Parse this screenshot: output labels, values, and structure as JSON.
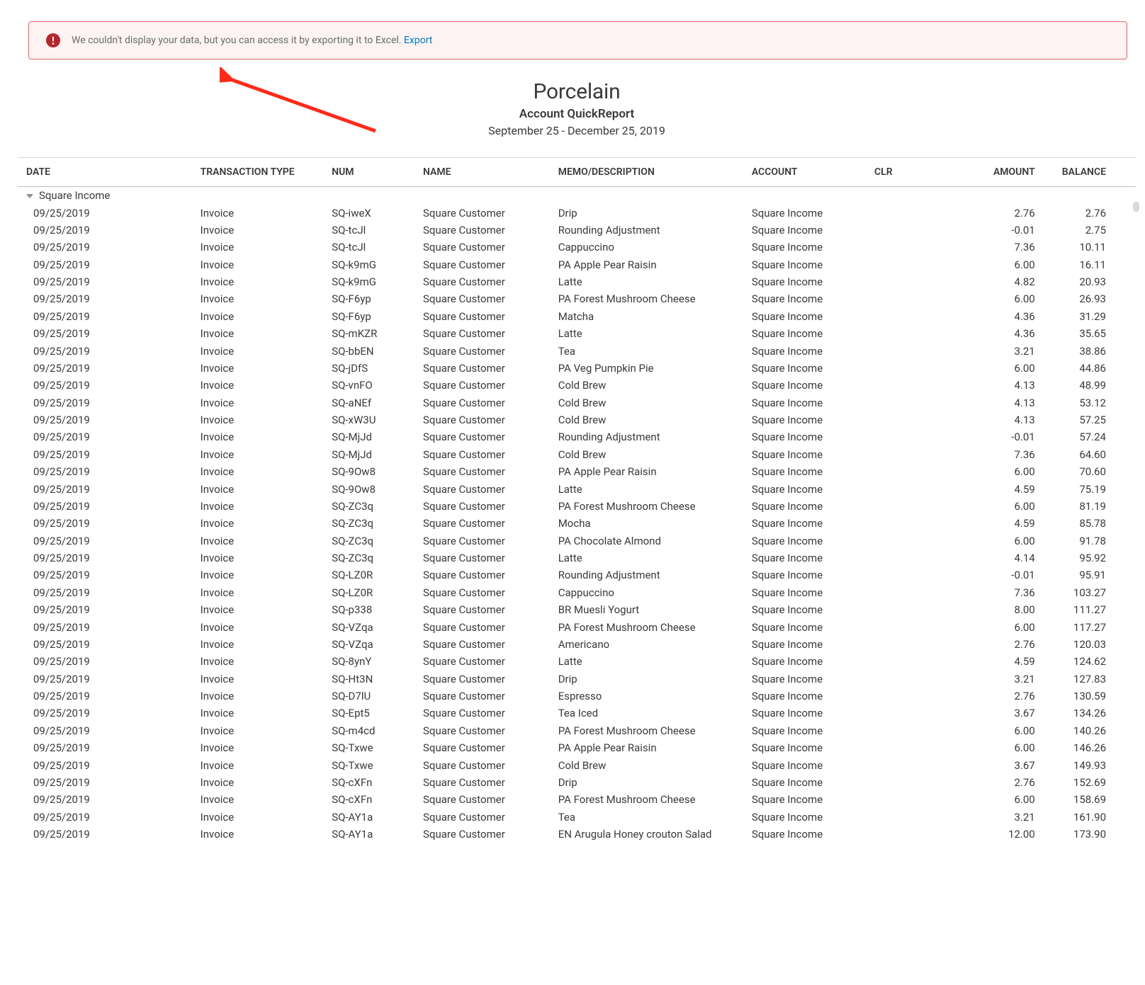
{
  "alert": {
    "text": "We couldn't display your data, but you can access it by exporting it to Excel. ",
    "link": "Export"
  },
  "header": {
    "company": "Porcelain",
    "title": "Account QuickReport",
    "period": "September 25 - December 25, 2019"
  },
  "columns": {
    "date": "DATE",
    "type": "TRANSACTION TYPE",
    "num": "NUM",
    "name": "NAME",
    "memo": "MEMO/DESCRIPTION",
    "account": "ACCOUNT",
    "clr": "CLR",
    "amount": "AMOUNT",
    "balance": "BALANCE"
  },
  "group_label": "Square Income",
  "rows": [
    {
      "date": "09/25/2019",
      "type": "Invoice",
      "num": "SQ-iweX",
      "name": "Square Customer",
      "memo": "Drip",
      "account": "Square Income",
      "clr": "",
      "amount": "2.76",
      "balance": "2.76"
    },
    {
      "date": "09/25/2019",
      "type": "Invoice",
      "num": "SQ-tcJl",
      "name": "Square Customer",
      "memo": "Rounding Adjustment",
      "account": "Square Income",
      "clr": "",
      "amount": "-0.01",
      "balance": "2.75"
    },
    {
      "date": "09/25/2019",
      "type": "Invoice",
      "num": "SQ-tcJl",
      "name": "Square Customer",
      "memo": "Cappuccino",
      "account": "Square Income",
      "clr": "",
      "amount": "7.36",
      "balance": "10.11"
    },
    {
      "date": "09/25/2019",
      "type": "Invoice",
      "num": "SQ-k9mG",
      "name": "Square Customer",
      "memo": "PA Apple Pear Raisin",
      "account": "Square Income",
      "clr": "",
      "amount": "6.00",
      "balance": "16.11"
    },
    {
      "date": "09/25/2019",
      "type": "Invoice",
      "num": "SQ-k9mG",
      "name": "Square Customer",
      "memo": "Latte",
      "account": "Square Income",
      "clr": "",
      "amount": "4.82",
      "balance": "20.93"
    },
    {
      "date": "09/25/2019",
      "type": "Invoice",
      "num": "SQ-F6yp",
      "name": "Square Customer",
      "memo": "PA Forest Mushroom Cheese",
      "account": "Square Income",
      "clr": "",
      "amount": "6.00",
      "balance": "26.93"
    },
    {
      "date": "09/25/2019",
      "type": "Invoice",
      "num": "SQ-F6yp",
      "name": "Square Customer",
      "memo": "Matcha",
      "account": "Square Income",
      "clr": "",
      "amount": "4.36",
      "balance": "31.29"
    },
    {
      "date": "09/25/2019",
      "type": "Invoice",
      "num": "SQ-mKZR",
      "name": "Square Customer",
      "memo": "Latte",
      "account": "Square Income",
      "clr": "",
      "amount": "4.36",
      "balance": "35.65"
    },
    {
      "date": "09/25/2019",
      "type": "Invoice",
      "num": "SQ-bbEN",
      "name": "Square Customer",
      "memo": "Tea",
      "account": "Square Income",
      "clr": "",
      "amount": "3.21",
      "balance": "38.86"
    },
    {
      "date": "09/25/2019",
      "type": "Invoice",
      "num": "SQ-jDfS",
      "name": "Square Customer",
      "memo": "PA Veg Pumpkin Pie",
      "account": "Square Income",
      "clr": "",
      "amount": "6.00",
      "balance": "44.86"
    },
    {
      "date": "09/25/2019",
      "type": "Invoice",
      "num": "SQ-vnFO",
      "name": "Square Customer",
      "memo": "Cold Brew",
      "account": "Square Income",
      "clr": "",
      "amount": "4.13",
      "balance": "48.99"
    },
    {
      "date": "09/25/2019",
      "type": "Invoice",
      "num": "SQ-aNEf",
      "name": "Square Customer",
      "memo": "Cold Brew",
      "account": "Square Income",
      "clr": "",
      "amount": "4.13",
      "balance": "53.12"
    },
    {
      "date": "09/25/2019",
      "type": "Invoice",
      "num": "SQ-xW3U",
      "name": "Square Customer",
      "memo": "Cold Brew",
      "account": "Square Income",
      "clr": "",
      "amount": "4.13",
      "balance": "57.25"
    },
    {
      "date": "09/25/2019",
      "type": "Invoice",
      "num": "SQ-MjJd",
      "name": "Square Customer",
      "memo": "Rounding Adjustment",
      "account": "Square Income",
      "clr": "",
      "amount": "-0.01",
      "balance": "57.24"
    },
    {
      "date": "09/25/2019",
      "type": "Invoice",
      "num": "SQ-MjJd",
      "name": "Square Customer",
      "memo": "Cold Brew",
      "account": "Square Income",
      "clr": "",
      "amount": "7.36",
      "balance": "64.60"
    },
    {
      "date": "09/25/2019",
      "type": "Invoice",
      "num": "SQ-9Ow8",
      "name": "Square Customer",
      "memo": "PA Apple Pear Raisin",
      "account": "Square Income",
      "clr": "",
      "amount": "6.00",
      "balance": "70.60"
    },
    {
      "date": "09/25/2019",
      "type": "Invoice",
      "num": "SQ-9Ow8",
      "name": "Square Customer",
      "memo": "Latte",
      "account": "Square Income",
      "clr": "",
      "amount": "4.59",
      "balance": "75.19"
    },
    {
      "date": "09/25/2019",
      "type": "Invoice",
      "num": "SQ-ZC3q",
      "name": "Square Customer",
      "memo": "PA Forest Mushroom Cheese",
      "account": "Square Income",
      "clr": "",
      "amount": "6.00",
      "balance": "81.19"
    },
    {
      "date": "09/25/2019",
      "type": "Invoice",
      "num": "SQ-ZC3q",
      "name": "Square Customer",
      "memo": "Mocha",
      "account": "Square Income",
      "clr": "",
      "amount": "4.59",
      "balance": "85.78"
    },
    {
      "date": "09/25/2019",
      "type": "Invoice",
      "num": "SQ-ZC3q",
      "name": "Square Customer",
      "memo": "PA Chocolate Almond",
      "account": "Square Income",
      "clr": "",
      "amount": "6.00",
      "balance": "91.78"
    },
    {
      "date": "09/25/2019",
      "type": "Invoice",
      "num": "SQ-ZC3q",
      "name": "Square Customer",
      "memo": "Latte",
      "account": "Square Income",
      "clr": "",
      "amount": "4.14",
      "balance": "95.92"
    },
    {
      "date": "09/25/2019",
      "type": "Invoice",
      "num": "SQ-LZ0R",
      "name": "Square Customer",
      "memo": "Rounding Adjustment",
      "account": "Square Income",
      "clr": "",
      "amount": "-0.01",
      "balance": "95.91"
    },
    {
      "date": "09/25/2019",
      "type": "Invoice",
      "num": "SQ-LZ0R",
      "name": "Square Customer",
      "memo": "Cappuccino",
      "account": "Square Income",
      "clr": "",
      "amount": "7.36",
      "balance": "103.27"
    },
    {
      "date": "09/25/2019",
      "type": "Invoice",
      "num": "SQ-p338",
      "name": "Square Customer",
      "memo": "BR Muesli Yogurt",
      "account": "Square Income",
      "clr": "",
      "amount": "8.00",
      "balance": "111.27"
    },
    {
      "date": "09/25/2019",
      "type": "Invoice",
      "num": "SQ-VZqa",
      "name": "Square Customer",
      "memo": "PA Forest Mushroom Cheese",
      "account": "Square Income",
      "clr": "",
      "amount": "6.00",
      "balance": "117.27"
    },
    {
      "date": "09/25/2019",
      "type": "Invoice",
      "num": "SQ-VZqa",
      "name": "Square Customer",
      "memo": "Americano",
      "account": "Square Income",
      "clr": "",
      "amount": "2.76",
      "balance": "120.03"
    },
    {
      "date": "09/25/2019",
      "type": "Invoice",
      "num": "SQ-8ynY",
      "name": "Square Customer",
      "memo": "Latte",
      "account": "Square Income",
      "clr": "",
      "amount": "4.59",
      "balance": "124.62"
    },
    {
      "date": "09/25/2019",
      "type": "Invoice",
      "num": "SQ-Ht3N",
      "name": "Square Customer",
      "memo": "Drip",
      "account": "Square Income",
      "clr": "",
      "amount": "3.21",
      "balance": "127.83"
    },
    {
      "date": "09/25/2019",
      "type": "Invoice",
      "num": "SQ-D7lU",
      "name": "Square Customer",
      "memo": "Espresso",
      "account": "Square Income",
      "clr": "",
      "amount": "2.76",
      "balance": "130.59"
    },
    {
      "date": "09/25/2019",
      "type": "Invoice",
      "num": "SQ-Ept5",
      "name": "Square Customer",
      "memo": "Tea Iced",
      "account": "Square Income",
      "clr": "",
      "amount": "3.67",
      "balance": "134.26"
    },
    {
      "date": "09/25/2019",
      "type": "Invoice",
      "num": "SQ-m4cd",
      "name": "Square Customer",
      "memo": "PA Forest Mushroom Cheese",
      "account": "Square Income",
      "clr": "",
      "amount": "6.00",
      "balance": "140.26"
    },
    {
      "date": "09/25/2019",
      "type": "Invoice",
      "num": "SQ-Txwe",
      "name": "Square Customer",
      "memo": "PA Apple Pear Raisin",
      "account": "Square Income",
      "clr": "",
      "amount": "6.00",
      "balance": "146.26"
    },
    {
      "date": "09/25/2019",
      "type": "Invoice",
      "num": "SQ-Txwe",
      "name": "Square Customer",
      "memo": "Cold Brew",
      "account": "Square Income",
      "clr": "",
      "amount": "3.67",
      "balance": "149.93"
    },
    {
      "date": "09/25/2019",
      "type": "Invoice",
      "num": "SQ-cXFn",
      "name": "Square Customer",
      "memo": "Drip",
      "account": "Square Income",
      "clr": "",
      "amount": "2.76",
      "balance": "152.69"
    },
    {
      "date": "09/25/2019",
      "type": "Invoice",
      "num": "SQ-cXFn",
      "name": "Square Customer",
      "memo": "PA Forest Mushroom Cheese",
      "account": "Square Income",
      "clr": "",
      "amount": "6.00",
      "balance": "158.69"
    },
    {
      "date": "09/25/2019",
      "type": "Invoice",
      "num": "SQ-AY1a",
      "name": "Square Customer",
      "memo": "Tea",
      "account": "Square Income",
      "clr": "",
      "amount": "3.21",
      "balance": "161.90"
    },
    {
      "date": "09/25/2019",
      "type": "Invoice",
      "num": "SQ-AY1a",
      "name": "Square Customer",
      "memo": "EN Arugula Honey crouton Salad",
      "account": "Square Income",
      "clr": "",
      "amount": "12.00",
      "balance": "173.90"
    }
  ]
}
